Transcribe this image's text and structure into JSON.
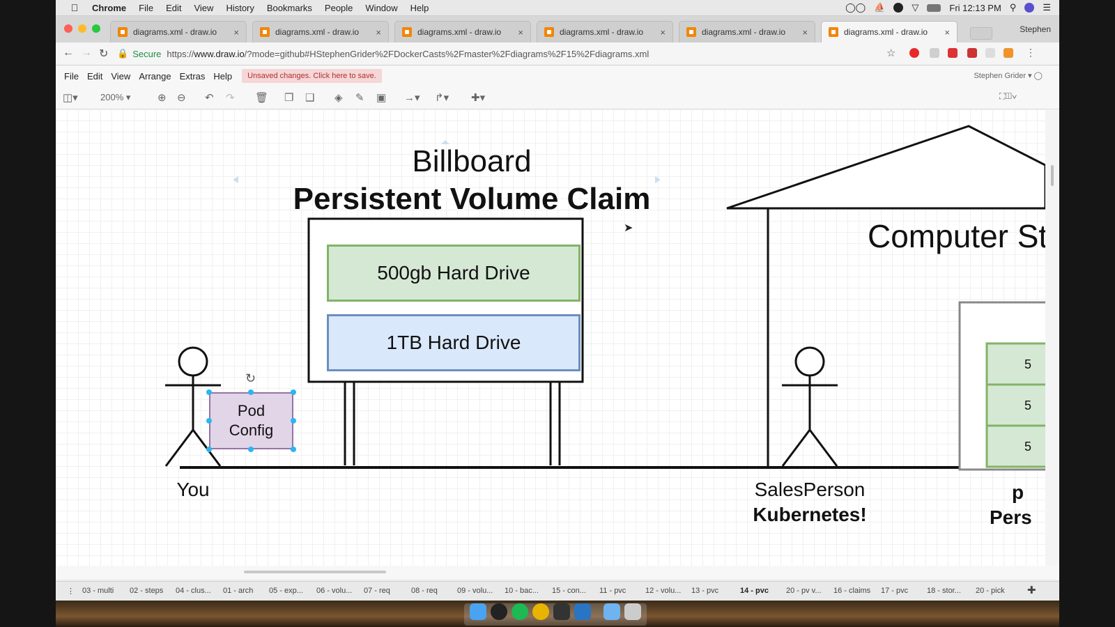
{
  "menubar": {
    "app": "Chrome",
    "items": [
      "File",
      "Edit",
      "View",
      "History",
      "Bookmarks",
      "People",
      "Window",
      "Help"
    ],
    "clock": "Fri 12:13 PM"
  },
  "tabs": {
    "items": [
      {
        "title": "diagrams.xml - draw.io"
      },
      {
        "title": "diagrams.xml - draw.io"
      },
      {
        "title": "diagrams.xml - draw.io"
      },
      {
        "title": "diagrams.xml - draw.io"
      },
      {
        "title": "diagrams.xml - draw.io"
      },
      {
        "title": "diagrams.xml - draw.io"
      }
    ],
    "profile": "Stephen"
  },
  "address": {
    "secure_label": "Secure",
    "url_prefix": "https://",
    "url_host": "www.draw.io",
    "url_rest": "/?mode=github#HStephenGrider%2FDockerCasts%2Fmaster%2Fdiagrams%2F15%2Fdiagrams.xml"
  },
  "app_menu": {
    "items": [
      "File",
      "Edit",
      "View",
      "Arrange",
      "Extras",
      "Help"
    ],
    "unsaved": "Unsaved changes. Click here to save.",
    "user": "Stephen Grider"
  },
  "toolbar": {
    "zoom": "200%"
  },
  "diagram": {
    "title1": "Billboard",
    "title2": "Persistent Volume Claim",
    "drive1": "500gb Hard Drive",
    "drive2": "1TB Hard Drive",
    "pod_line1": "Pod",
    "pod_line2": "Config",
    "you": "You",
    "sales1": "SalesPerson",
    "sales2": "Kubernetes!",
    "store": "Computer St",
    "shelf_labels": [
      "5",
      "5",
      "5"
    ],
    "cut_label1": "p",
    "cut_label2": "Pers"
  },
  "pages": {
    "items": [
      "03 - multi",
      "02 - steps",
      "04 - clus...",
      "01 - arch",
      "05 - exp...",
      "06 - volu...",
      "07 - req",
      "08 - req",
      "09 - volu...",
      "10 - bac...",
      "15 - con...",
      "11 - pvc",
      "12 - volu...",
      "13 - pvc",
      "14 - pvc",
      "20 - pv v...",
      "16 - claims",
      "17 - pvc",
      "18 - stor...",
      "20 - pick"
    ],
    "active": "14 - pvc"
  },
  "colors": {
    "green_fill": "#d5e8d4",
    "blue_fill": "#dae8fc",
    "purple_fill": "#e1d5e7",
    "unsaved_bg": "#f6d6d6"
  }
}
